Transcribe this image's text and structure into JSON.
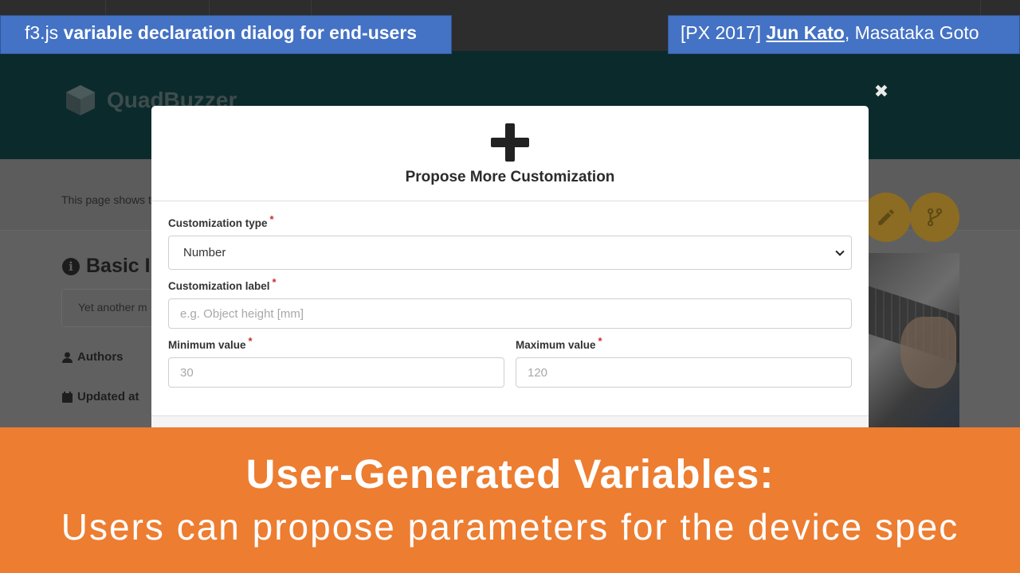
{
  "app": {
    "brand": "QuadBuzzer",
    "description_fragment": "This page shows t",
    "section_heading": "Basic In",
    "section_input_value": "Yet another m",
    "authors_label": "Authors",
    "updated_label": "Updated at"
  },
  "modal": {
    "title": "Propose More Customization",
    "close_symbol": "✖",
    "fields": {
      "type_label": "Customization type",
      "type_value": "Number",
      "label_label": "Customization label",
      "label_placeholder": "e.g. Object height [mm]",
      "min_label": "Minimum value",
      "min_placeholder": "30",
      "max_label": "Maximum value",
      "max_placeholder": "120",
      "required_mark": "*"
    }
  },
  "overlay": {
    "left_tag_prefix": "f3.js",
    "left_tag_bold": "variable declaration dialog for end-users",
    "right_tag_prefix": "[PX 2017]",
    "right_tag_author": "Jun Kato",
    "right_tag_rest": ", Masataka Goto",
    "headline": "User-Generated Variables:",
    "subline": "Users can propose parameters for the device spec"
  },
  "colors": {
    "tag_blue": "#4472c4",
    "banner_orange": "#ed7d31",
    "required_red": "#cc2b2b",
    "fab_gold": "#8c6c22"
  }
}
